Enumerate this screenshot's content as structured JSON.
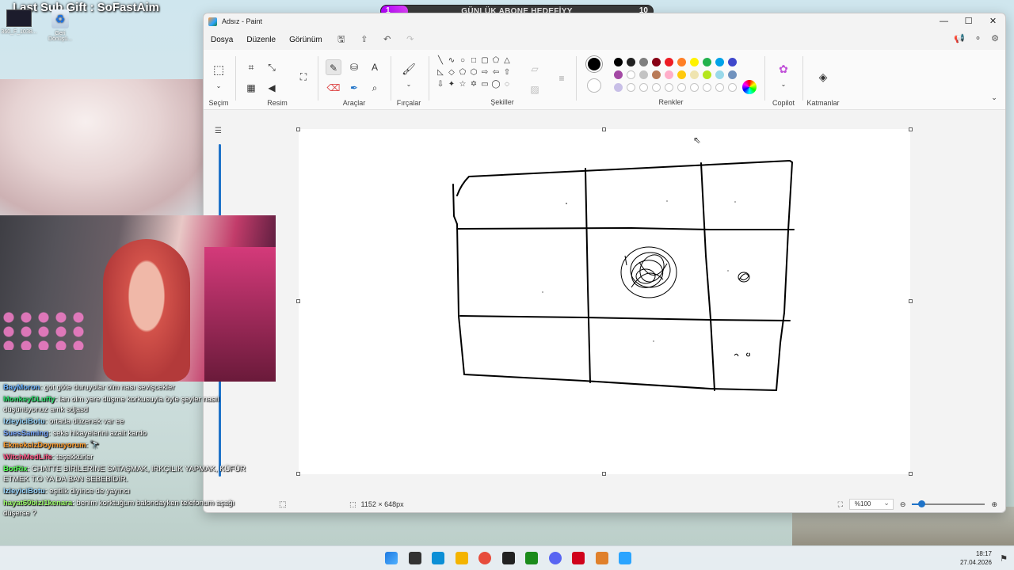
{
  "stream": {
    "top_text": "Last Sub Gift : SoFastAim",
    "goal": {
      "title": "GÜNLÜK ABONE HEDEFİYY",
      "current": "1",
      "target": "10",
      "progress": 0.1
    }
  },
  "desktop_icons": [
    {
      "label": "360_F_1038...",
      "icon": "image-thumbnail-icon"
    },
    {
      "label": "Geri Dönüşü...",
      "icon": "recycle-bin-icon"
    }
  ],
  "paint": {
    "title": "Adsız - Paint",
    "menu": [
      "Dosya",
      "Düzenle",
      "Görünüm"
    ],
    "groups": [
      "Seçim",
      "Resim",
      "Araçlar",
      "Fırçalar",
      "Şekiller",
      "Renkler",
      "Copilot",
      "Katmanlar"
    ],
    "colors": [
      "#000000",
      "#222222",
      "#7f7f7f",
      "#880015",
      "#ed1c24",
      "#ff7f27",
      "#fff200",
      "#22b14c",
      "#00a2e8",
      "#3f48cc",
      "#a349a4",
      "#ffffff",
      "#c3c3c3",
      "#b97a57",
      "#ffaec9",
      "#ffc90e",
      "#efe4b0",
      "#b5e61d",
      "#99d9ea",
      "#7092be",
      "#c8bfe7"
    ],
    "status": {
      "dimensions": "1152 × 648px",
      "zoom": "%100"
    }
  },
  "chat": [
    {
      "user": "BayMoron",
      "color": "#6bb3ff",
      "text": "got göte duruyolar olm nası sevişcekler"
    },
    {
      "user": "MonkeyDLuffy",
      "color": "#2fe06f",
      "text": "lan olm yere düşme korkusuyla öyle şeyler nasıl düşünüyonuz amk sdjasd"
    },
    {
      "user": "IzleyiciBotu",
      "color": "#9ad7ff",
      "text": "ortada düzenek var ee"
    },
    {
      "user": "SuesSaming",
      "color": "#7aa8ff",
      "text": "seks hikayelerini azalt kardo"
    },
    {
      "user": "EkmeksizDoymuyorum",
      "color": "#ff9d2e",
      "text": "🔭"
    },
    {
      "user": "WitchMedLife",
      "color": "#ff5c8a",
      "text": "teşekkürler"
    },
    {
      "user": "BotRix",
      "color": "#55ff55",
      "text": "CHATTE BİRİLERİNE SATAŞMAK, IRKÇILIK YAPMAK, KÜFÜR ETMEK T.O YA DA BAN SEBEBİDİR."
    },
    {
      "user": "IzleyiciBotu",
      "color": "#9ad7ff",
      "text": "eşitlik diyince de yayıncı"
    },
    {
      "user": "hayat60bizi1kenara",
      "color": "#9dff6b",
      "text": "benim korktuğum balondayken telefonum aşağı düşerse ?"
    }
  ],
  "taskbar": {
    "apps": [
      "windows-start-icon",
      "terminal-icon",
      "edge-icon",
      "file-explorer-icon",
      "chrome-icon",
      "obs-icon",
      "terminal-green-icon",
      "discord-icon",
      "app-red-icon",
      "app-orange-icon",
      "paint-icon"
    ],
    "time": "18:17",
    "date": "27.04.2026"
  }
}
